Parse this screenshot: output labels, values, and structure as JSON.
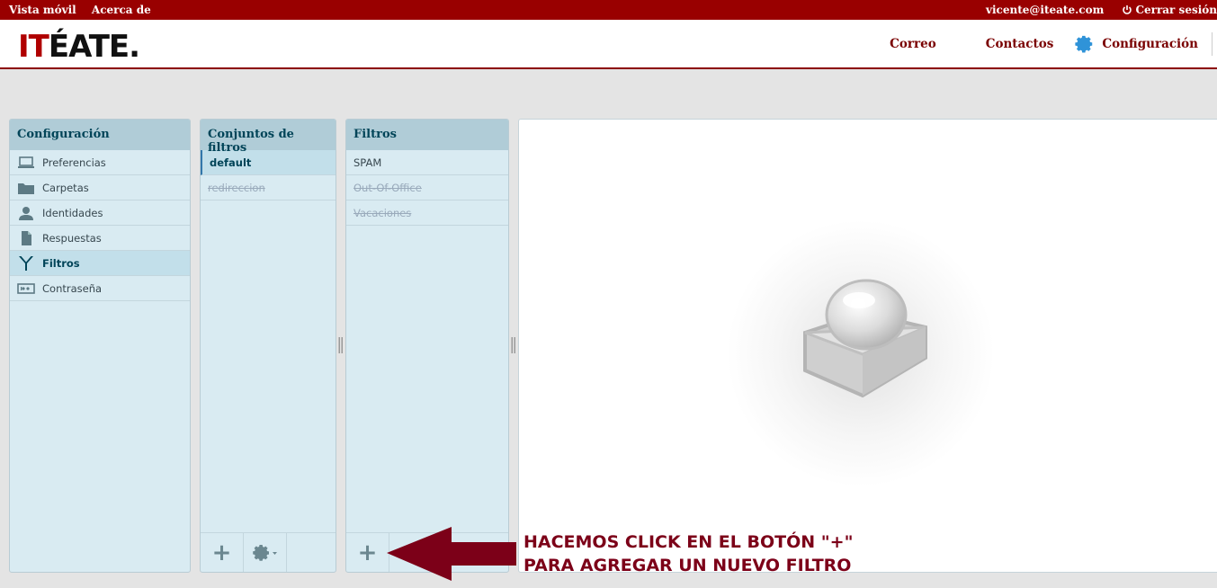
{
  "topbar": {
    "links": [
      "Vista móvil",
      "Acerca de"
    ],
    "user": "vicente@iteate.com",
    "logout": "Cerrar sesión"
  },
  "header": {
    "logo_red": "IT",
    "logo_black": "ÉATE.",
    "nav": {
      "correo": "Correo",
      "contactos": "Contactos",
      "configuracion": "Configuración"
    }
  },
  "settings_panel": {
    "title": "Configuración",
    "items": [
      {
        "label": "Preferencias",
        "icon": "laptop-icon"
      },
      {
        "label": "Carpetas",
        "icon": "folder-icon"
      },
      {
        "label": "Identidades",
        "icon": "user-icon"
      },
      {
        "label": "Respuestas",
        "icon": "document-icon"
      },
      {
        "label": "Filtros",
        "icon": "filter-icon",
        "selected": true
      },
      {
        "label": "Contraseña",
        "icon": "password-icon"
      }
    ]
  },
  "filtersets_panel": {
    "title": "Conjuntos de filtros",
    "items": [
      {
        "label": "default",
        "selected": true
      },
      {
        "label": "redireccion",
        "disabled": true
      }
    ]
  },
  "filters_panel": {
    "title": "Filtros",
    "items": [
      {
        "label": "SPAM"
      },
      {
        "label": "Out-Of-Office",
        "disabled": true
      },
      {
        "label": "Vacaciones",
        "disabled": true
      }
    ]
  },
  "annotation": {
    "line1": "HACEMOS CLICK EN EL BOTÓN \"+\"",
    "line2": "PARA AGREGAR UN NUEVO FILTRO"
  },
  "colors": {
    "brand": "#990000",
    "panel_bg": "#d9ebf2",
    "panel_header": "#b0ccd7",
    "annotation": "#7c0018"
  }
}
